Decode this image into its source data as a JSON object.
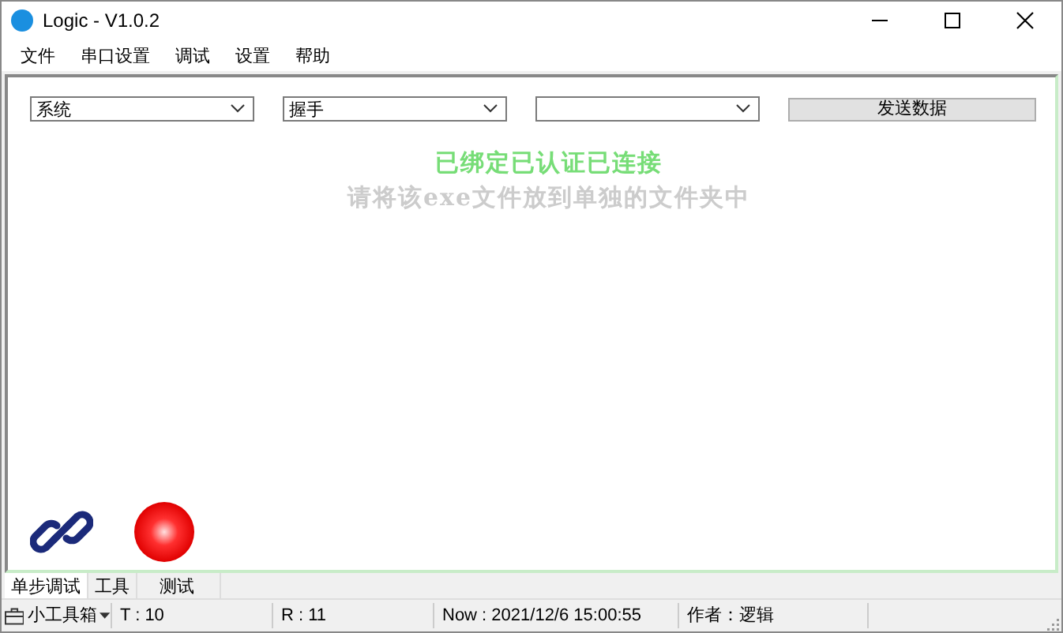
{
  "window": {
    "title": "Logic - V1.0.2"
  },
  "menu": [
    "文件",
    "串口设置",
    "调试",
    "设置",
    "帮助"
  ],
  "combos": [
    {
      "kind": "select",
      "value": "系统"
    },
    {
      "kind": "select",
      "value": "握手"
    },
    {
      "kind": "select"
    }
  ],
  "send_button": "发送数据",
  "messages": [
    {
      "kind": "status",
      "text": "已绑定已认证已连接"
    },
    {
      "kind": "hint",
      "text": "请将该exe文件放到单独的文件夹中"
    }
  ],
  "tabs": [
    {
      "label": "单步调试",
      "selected": true
    },
    {
      "label": "工具",
      "selected": false
    },
    {
      "label": "测试",
      "selected": false
    }
  ],
  "status_bar": {
    "toolbox": "小工具箱",
    "fields": [
      "T : 10",
      "R : 11",
      "Now : 2021/12/6 15:00:55",
      "作者：逻辑"
    ]
  }
}
